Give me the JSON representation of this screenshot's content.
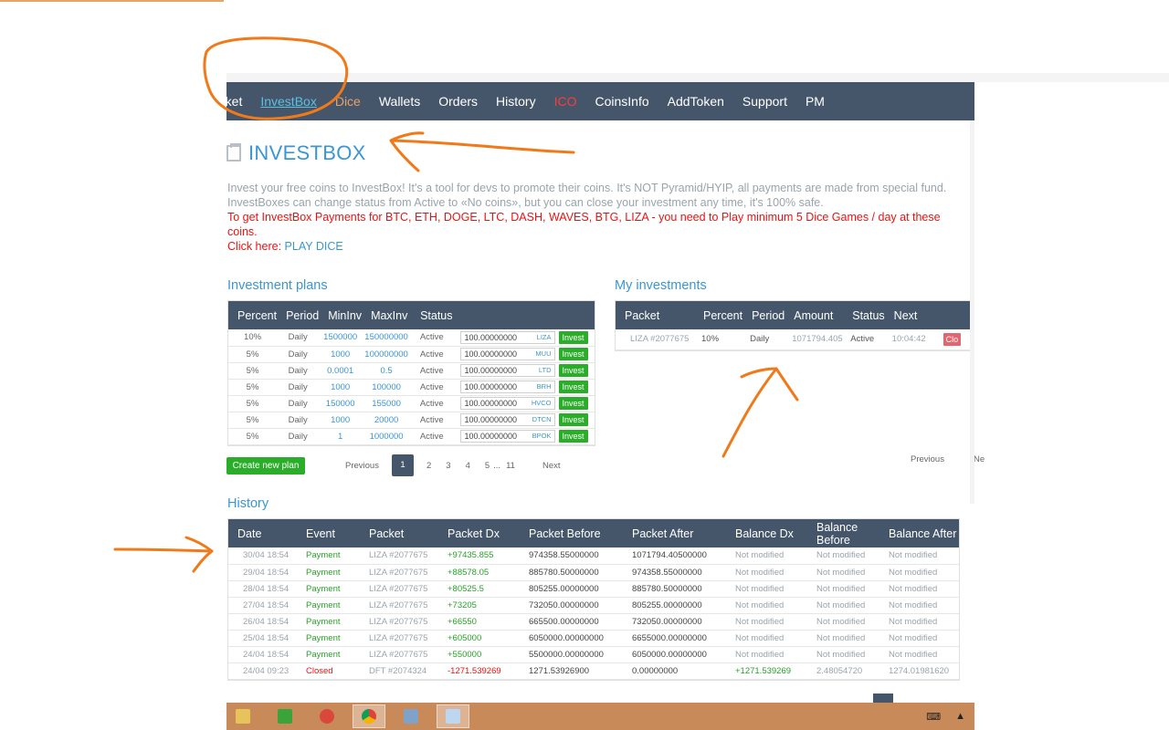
{
  "nav": {
    "items": [
      {
        "label": "rket",
        "style": "first"
      },
      {
        "label": "InvestBox",
        "style": "active"
      },
      {
        "label": "Dice",
        "style": "dice"
      },
      {
        "label": "Wallets",
        "style": ""
      },
      {
        "label": "Orders",
        "style": ""
      },
      {
        "label": "History",
        "style": ""
      },
      {
        "label": "ICO",
        "style": "ico"
      },
      {
        "label": "CoinsInfo",
        "style": ""
      },
      {
        "label": "AddToken",
        "style": ""
      },
      {
        "label": "Support",
        "style": ""
      },
      {
        "label": "PM",
        "style": ""
      }
    ]
  },
  "page": {
    "title": "INVESTBOX",
    "intro_line1": "Invest your free coins to InvestBox! It's a tool for devs to promote their coins. It's NOT Pyramid/HYIP, all payments are made from special fund.",
    "intro_line2": "InvestBoxes can change status from Active to «No coins», but you can close your investment any time, it's 100% safe.",
    "intro_line3": "To get InvestBox Payments for BTC, ETH, DOGE, LTC, DASH, WAVES, BTG, LIZA - you need to Play minimum 5 Dice Games / day at these coins.",
    "intro_click": "Click here:",
    "intro_link": "PLAY DICE"
  },
  "plans": {
    "title": "Investment plans",
    "headers": [
      "Percent",
      "Period",
      "MinInv",
      "MaxInv",
      "Status"
    ],
    "invest_label": "Invest",
    "rows": [
      {
        "percent": "10%",
        "period": "Daily",
        "min": "1500000",
        "max": "150000000",
        "status": "Active",
        "amount": "100.00000000",
        "coin": "LIZA"
      },
      {
        "percent": "5%",
        "period": "Daily",
        "min": "1000",
        "max": "100000000",
        "status": "Active",
        "amount": "100.00000000",
        "coin": "MUU"
      },
      {
        "percent": "5%",
        "period": "Daily",
        "min": "0.0001",
        "max": "0.5",
        "status": "Active",
        "amount": "100.00000000",
        "coin": "LTD"
      },
      {
        "percent": "5%",
        "period": "Daily",
        "min": "1000",
        "max": "100000",
        "status": "Active",
        "amount": "100.00000000",
        "coin": "BRH"
      },
      {
        "percent": "5%",
        "period": "Daily",
        "min": "150000",
        "max": "155000",
        "status": "Active",
        "amount": "100.00000000",
        "coin": "HVCO"
      },
      {
        "percent": "5%",
        "period": "Daily",
        "min": "1000",
        "max": "20000",
        "status": "Active",
        "amount": "100.00000000",
        "coin": "DTCN"
      },
      {
        "percent": "5%",
        "period": "Daily",
        "min": "1",
        "max": "1000000",
        "status": "Active",
        "amount": "100.00000000",
        "coin": "BPOK"
      }
    ],
    "create_label": "Create new plan",
    "pager": {
      "prev": "Previous",
      "pages": [
        "1",
        "2",
        "3",
        "4",
        "5"
      ],
      "ellipsis": "...",
      "last": "11",
      "next": "Next",
      "current": "1"
    }
  },
  "my_investments": {
    "title": "My investments",
    "headers": [
      "Packet",
      "Percent",
      "Period",
      "Amount",
      "Status",
      "Next"
    ],
    "rows": [
      {
        "packet": "LIZA #2077675",
        "percent": "10%",
        "period": "Daily",
        "amount": "1071794.405",
        "status": "Active",
        "next": "10:04:42",
        "action": "Clo"
      }
    ],
    "pager": {
      "prev": "Previous",
      "next": "Ne"
    }
  },
  "history": {
    "title": "History",
    "headers": [
      "Date",
      "Event",
      "Packet",
      "Packet Dx",
      "Packet Before",
      "Packet After",
      "Balance Dx",
      "Balance Before",
      "Balance After"
    ],
    "rows": [
      {
        "date": "30/04 18:54",
        "event": "Payment",
        "packet": "LIZA #2077675",
        "pdx": "+97435.855",
        "pbefore": "974358.55000000",
        "pafter": "1071794.40500000",
        "bdx": "Not modified",
        "bbefore": "Not modified",
        "bafter": "Not modified",
        "kind": "payment"
      },
      {
        "date": "29/04 18:54",
        "event": "Payment",
        "packet": "LIZA #2077675",
        "pdx": "+88578.05",
        "pbefore": "885780.50000000",
        "pafter": "974358.55000000",
        "bdx": "Not modified",
        "bbefore": "Not modified",
        "bafter": "Not modified",
        "kind": "payment"
      },
      {
        "date": "28/04 18:54",
        "event": "Payment",
        "packet": "LIZA #2077675",
        "pdx": "+80525.5",
        "pbefore": "805255.00000000",
        "pafter": "885780.50000000",
        "bdx": "Not modified",
        "bbefore": "Not modified",
        "bafter": "Not modified",
        "kind": "payment"
      },
      {
        "date": "27/04 18:54",
        "event": "Payment",
        "packet": "LIZA #2077675",
        "pdx": "+73205",
        "pbefore": "732050.00000000",
        "pafter": "805255.00000000",
        "bdx": "Not modified",
        "bbefore": "Not modified",
        "bafter": "Not modified",
        "kind": "payment"
      },
      {
        "date": "26/04 18:54",
        "event": "Payment",
        "packet": "LIZA #2077675",
        "pdx": "+66550",
        "pbefore": "665500.00000000",
        "pafter": "732050.00000000",
        "bdx": "Not modified",
        "bbefore": "Not modified",
        "bafter": "Not modified",
        "kind": "payment"
      },
      {
        "date": "25/04 18:54",
        "event": "Payment",
        "packet": "LIZA #2077675",
        "pdx": "+605000",
        "pbefore": "6050000.00000000",
        "pafter": "6655000.00000000",
        "bdx": "Not modified",
        "bbefore": "Not modified",
        "bafter": "Not modified",
        "kind": "payment"
      },
      {
        "date": "24/04 18:54",
        "event": "Payment",
        "packet": "LIZA #2077675",
        "pdx": "+550000",
        "pbefore": "5500000.00000000",
        "pafter": "6050000.00000000",
        "bdx": "Not modified",
        "bbefore": "Not modified",
        "bafter": "Not modified",
        "kind": "payment"
      },
      {
        "date": "24/04 09:23",
        "event": "Closed",
        "packet": "DFT #2074324",
        "pdx": "-1271.539269",
        "pbefore": "1271.53926900",
        "pafter": "0.00000000",
        "bdx": "+1271.539269",
        "bbefore": "2.48054720",
        "bafter": "1274.01981620",
        "kind": "closed"
      }
    ]
  },
  "colors": {
    "navbar": "#45566b",
    "accent_blue": "#3a96d4",
    "green": "#2aae2a",
    "red": "#ee1111",
    "annotation_orange": "#f07a1a",
    "taskbar": "#c98a5a"
  }
}
